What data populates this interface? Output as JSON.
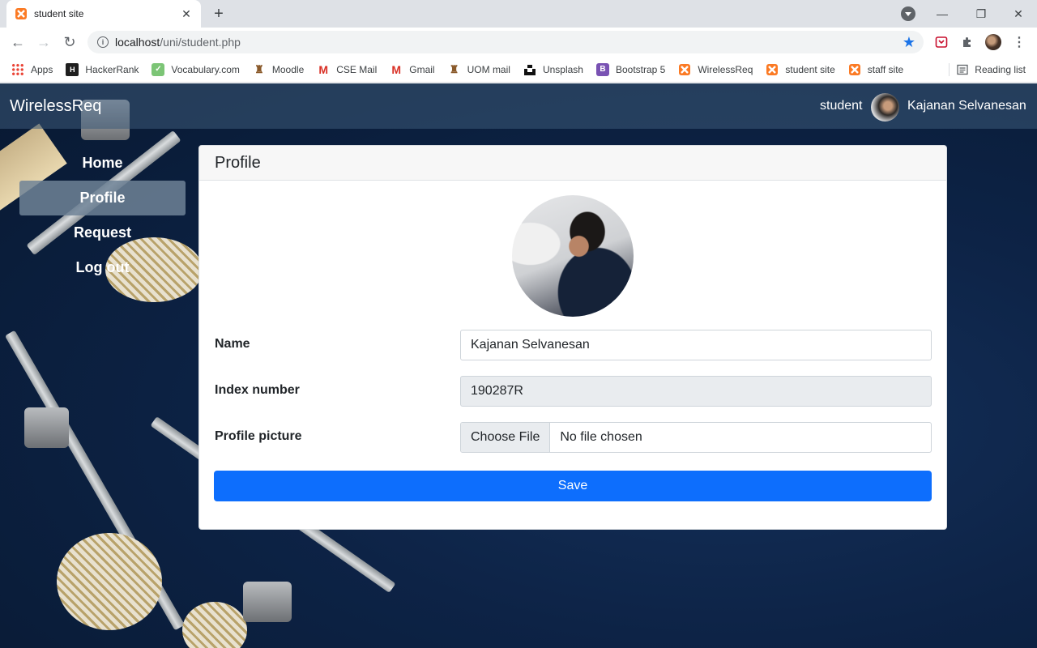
{
  "browser": {
    "tab_title": "student site",
    "url_host": "localhost",
    "url_path": "/uni/student.php",
    "bookmarks": [
      {
        "label": "Apps",
        "icon": "apps-grid-icon"
      },
      {
        "label": "HackerRank",
        "icon": "hackerrank-icon"
      },
      {
        "label": "Vocabulary.com",
        "icon": "vocabulary-icon"
      },
      {
        "label": "Moodle",
        "icon": "moodle-icon"
      },
      {
        "label": "CSE Mail",
        "icon": "gmail-icon"
      },
      {
        "label": "Gmail",
        "icon": "gmail-icon"
      },
      {
        "label": "UOM mail",
        "icon": "uom-icon"
      },
      {
        "label": "Unsplash",
        "icon": "unsplash-icon"
      },
      {
        "label": "Bootstrap 5",
        "icon": "bootstrap-icon"
      },
      {
        "label": "WirelessReq",
        "icon": "xampp-icon"
      },
      {
        "label": "student site",
        "icon": "xampp-icon"
      },
      {
        "label": "staff site",
        "icon": "xampp-icon"
      }
    ],
    "reading_list": "Reading list"
  },
  "nav": {
    "brand": "WirelessReq",
    "role": "student",
    "user_name": "Kajanan Selvanesan"
  },
  "sidebar": {
    "items": [
      {
        "label": "Home",
        "active": false
      },
      {
        "label": "Profile",
        "active": true
      },
      {
        "label": "Request",
        "active": false
      },
      {
        "label": "Log out",
        "active": false
      }
    ]
  },
  "card": {
    "title": "Profile",
    "fields": {
      "name_label": "Name",
      "name_value": "Kajanan Selvanesan",
      "index_label": "Index number",
      "index_value": "190287R",
      "picture_label": "Profile picture",
      "file_button": "Choose File",
      "file_status": "No file chosen"
    },
    "save_label": "Save"
  },
  "colors": {
    "primary": "#0d6efd",
    "page_bg": "#0d2346",
    "favorite_star": "#1a73e8"
  }
}
